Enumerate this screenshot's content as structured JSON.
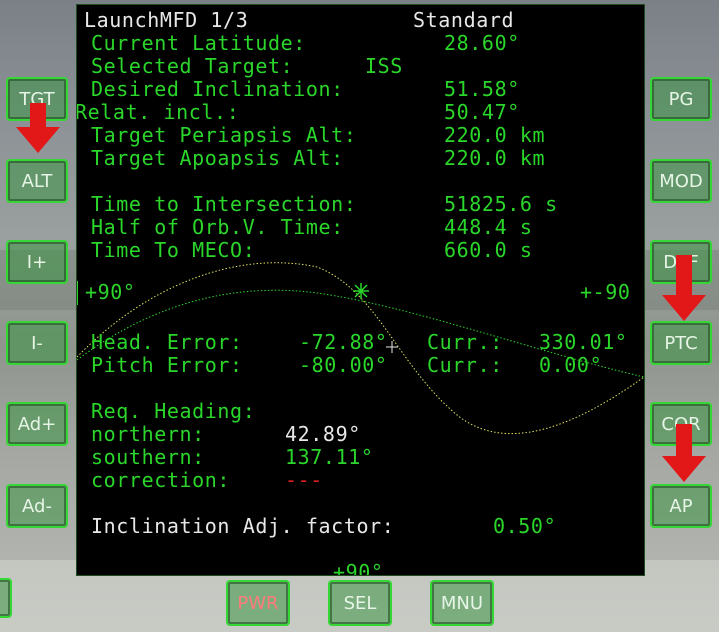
{
  "mfd": {
    "title": "LaunchMFD 1/3",
    "mode": "Standard",
    "current_latitude": {
      "label": "Current Latitude:",
      "value": "28.60°"
    },
    "selected_target": {
      "label": "Selected Target:",
      "value": "ISS"
    },
    "desired_inclination": {
      "label": "Desired Inclination:",
      "value": "51.58°"
    },
    "relat_incl": {
      "label": "Relat. incl.:",
      "value": "50.47°"
    },
    "target_periapsis": {
      "label": "Target Periapsis Alt:",
      "value": "220.0 km"
    },
    "target_apoapsis": {
      "label": "Target Apoapsis Alt:",
      "value": "220.0 km"
    },
    "time_to_intersection": {
      "label": "Time to Intersection:",
      "value": "51825.6 s"
    },
    "half_orb_v_time": {
      "label": "Half of Orb.V. Time:",
      "value": "448.4 s"
    },
    "time_to_meco": {
      "label": "Time To MECO:",
      "value": "660.0 s"
    },
    "scale_left": "+90°",
    "scale_right": "+-90",
    "scale_bottom": "+90°",
    "head_error": {
      "label": "Head. Error:",
      "value": "-72.88°",
      "curr_label": "Curr.:",
      "curr_value": "330.01°"
    },
    "pitch_error": {
      "label": "Pitch Error:",
      "value": "-80.00°",
      "curr_label": "Curr.:",
      "curr_value": "0.00°"
    },
    "req_heading": {
      "label": "Req. Heading:"
    },
    "northern": {
      "label": "northern:",
      "value": "42.89°"
    },
    "southern": {
      "label": "southern:",
      "value": "137.11°"
    },
    "correction": {
      "label": "correction:",
      "value": "---"
    },
    "incl_adj_factor": {
      "label": "Inclination Adj. factor:",
      "value": "0.50°"
    }
  },
  "buttons": {
    "left": [
      "TGT",
      "ALT",
      "I+",
      "I-",
      "Ad+",
      "Ad-"
    ],
    "right": [
      "PG",
      "MOD",
      "DEF",
      "PTC",
      "COR",
      "AP"
    ],
    "bottom": [
      "PWR",
      "SEL",
      "MNU"
    ]
  },
  "colors": {
    "text_green": "#2bd62b",
    "text_white": "#e8e8e8",
    "alert_red": "#e02020",
    "button_border": "#36d636",
    "arrow_red": "#e21818"
  }
}
